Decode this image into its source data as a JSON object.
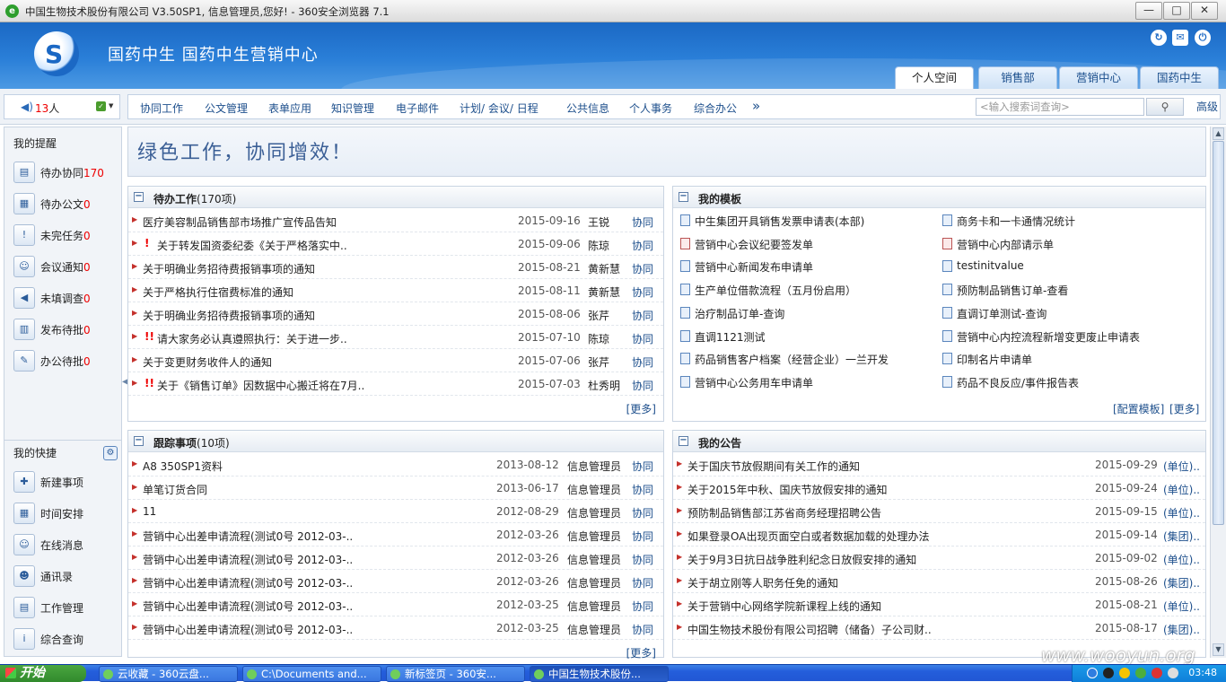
{
  "window": {
    "title": "中国生物技术股份有限公司 V3.50SP1, 信息管理员,您好! - 360安全浏览器 7.1"
  },
  "header": {
    "title": "国药中生 国药中生营销中心",
    "tabs": [
      "个人空间",
      "销售部",
      "营销中心",
      "国药中生"
    ]
  },
  "online": {
    "count_num": "13",
    "count_unit": "人"
  },
  "menu": {
    "items": [
      "协同工作",
      "公文管理",
      "表单应用",
      "知识管理",
      "电子邮件",
      "计划/ 会议/ 日程",
      "公共信息",
      "个人事务",
      "综合办公"
    ],
    "more": "»",
    "search_placeholder": "<输入搜索词查询>",
    "advanced": "高级"
  },
  "sidebar": {
    "reminders_title": "我的提醒",
    "reminders": [
      {
        "label": "待办协同",
        "count": "170"
      },
      {
        "label": "待办公文",
        "count": "0"
      },
      {
        "label": "未完任务",
        "count": "0"
      },
      {
        "label": "会议通知",
        "count": "0"
      },
      {
        "label": "未填调查",
        "count": "0"
      },
      {
        "label": "发布待批",
        "count": "0"
      },
      {
        "label": "办公待批",
        "count": "0"
      }
    ],
    "shortcuts_title": "我的快捷",
    "shortcuts": [
      "新建事项",
      "时间安排",
      "在线消息",
      "通讯录",
      "工作管理",
      "综合查询"
    ]
  },
  "slogan": "绿色工作，协同增效！",
  "todo": {
    "title": "待办工作",
    "count": "(170项)",
    "more": "[更多]",
    "rows": [
      {
        "title": "医疗美容制品销售部市场推广宣传品告知",
        "date": "2015-09-16",
        "person": "王锐",
        "type": "协同",
        "urgent": 0
      },
      {
        "title": "关于转发国资委纪委《关于严格落实中..",
        "date": "2015-09-06",
        "person": "陈琼",
        "type": "协同",
        "urgent": 1
      },
      {
        "title": "关于明确业务招待费报销事项的通知",
        "date": "2015-08-21",
        "person": "黄新慧",
        "type": "协同",
        "urgent": 0
      },
      {
        "title": "关于严格执行住宿费标准的通知",
        "date": "2015-08-11",
        "person": "黄新慧",
        "type": "协同",
        "urgent": 0
      },
      {
        "title": "关于明确业务招待费报销事项的通知",
        "date": "2015-08-06",
        "person": "张芹",
        "type": "协同",
        "urgent": 0
      },
      {
        "title": "请大家务必认真遵照执行：关于进一步..",
        "date": "2015-07-10",
        "person": "陈琼",
        "type": "协同",
        "urgent": 2
      },
      {
        "title": "关于变更财务收件人的通知",
        "date": "2015-07-06",
        "person": "张芹",
        "type": "协同",
        "urgent": 0
      },
      {
        "title": "关于《销售订单》因数据中心搬迁将在7月..",
        "date": "2015-07-03",
        "person": "杜秀明",
        "type": "协同",
        "urgent": 2
      }
    ]
  },
  "templates": {
    "title": "我的模板",
    "config": "[配置模板]",
    "more": "[更多]",
    "items": [
      "中生集团开具销售发票申请表(本部)",
      "商务卡和一卡通情况统计",
      "营销中心会议纪要签发单",
      "营销中心内部请示单",
      "营销中心新闻发布申请单",
      "testinitvalue",
      "生产单位借款流程（五月份启用）",
      "预防制品销售订单-查看",
      "治疗制品订单-查询",
      "直调订单测试-查询",
      "直调1121测试",
      "营销中心内控流程新增变更废止申请表",
      "药品销售客户档案（经营企业）一兰开发",
      "印制名片申请单",
      "营销中心公务用车申请单",
      "药品不良反应/事件报告表"
    ]
  },
  "tracking": {
    "title": "跟踪事项",
    "count": "(10项)",
    "more": "[更多]",
    "rows": [
      {
        "title": "A8 350SP1资料",
        "date": "2013-08-12",
        "person": "信息管理员",
        "type": "协同"
      },
      {
        "title": "单笔订货合同",
        "date": "2013-06-17",
        "person": "信息管理员",
        "type": "协同"
      },
      {
        "title": "11",
        "date": "2012-08-29",
        "person": "信息管理员",
        "type": "协同"
      },
      {
        "title": "营销中心出差申请流程(测试0号  2012-03-..",
        "date": "2012-03-26",
        "person": "信息管理员",
        "type": "协同"
      },
      {
        "title": "营销中心出差申请流程(测试0号  2012-03-..",
        "date": "2012-03-26",
        "person": "信息管理员",
        "type": "协同"
      },
      {
        "title": "营销中心出差申请流程(测试0号  2012-03-..",
        "date": "2012-03-26",
        "person": "信息管理员",
        "type": "协同"
      },
      {
        "title": "营销中心出差申请流程(测试0号  2012-03-..",
        "date": "2012-03-25",
        "person": "信息管理员",
        "type": "协同"
      },
      {
        "title": "营销中心出差申请流程(测试0号  2012-03-..",
        "date": "2012-03-25",
        "person": "信息管理员",
        "type": "协同"
      }
    ]
  },
  "notices": {
    "title": "我的公告",
    "rows": [
      {
        "title": "关于国庆节放假期间有关工作的通知",
        "date": "2015-09-29",
        "src": "(单位)..."
      },
      {
        "title": "关于2015年中秋、国庆节放假安排的通知",
        "date": "2015-09-24",
        "src": "(单位)..."
      },
      {
        "title": "预防制品销售部江苏省商务经理招聘公告",
        "date": "2015-09-15",
        "src": "(单位)..."
      },
      {
        "title": "如果登录OA出现页面空白或者数据加载的处理办法",
        "date": "2015-09-14",
        "src": "(集团)..."
      },
      {
        "title": "关于9月3日抗日战争胜利纪念日放假安排的通知",
        "date": "2015-09-02",
        "src": "(单位)..."
      },
      {
        "title": "关于胡立刚等人职务任免的通知",
        "date": "2015-08-26",
        "src": "(集团)..."
      },
      {
        "title": "关于营销中心网络学院新课程上线的通知",
        "date": "2015-08-21",
        "src": "(单位)..."
      },
      {
        "title": "中国生物技术股份有限公司招聘（储备）子公司财..",
        "date": "2015-08-17",
        "src": "(集团)..."
      }
    ]
  },
  "taskbar": {
    "start": "开始",
    "tasks": [
      "云收藏 - 360云盘...",
      "C:\\Documents and...",
      "新标签页 - 360安...",
      "中国生物技术股份..."
    ],
    "clock": "03:48"
  },
  "watermark": "www.wooyun.org"
}
